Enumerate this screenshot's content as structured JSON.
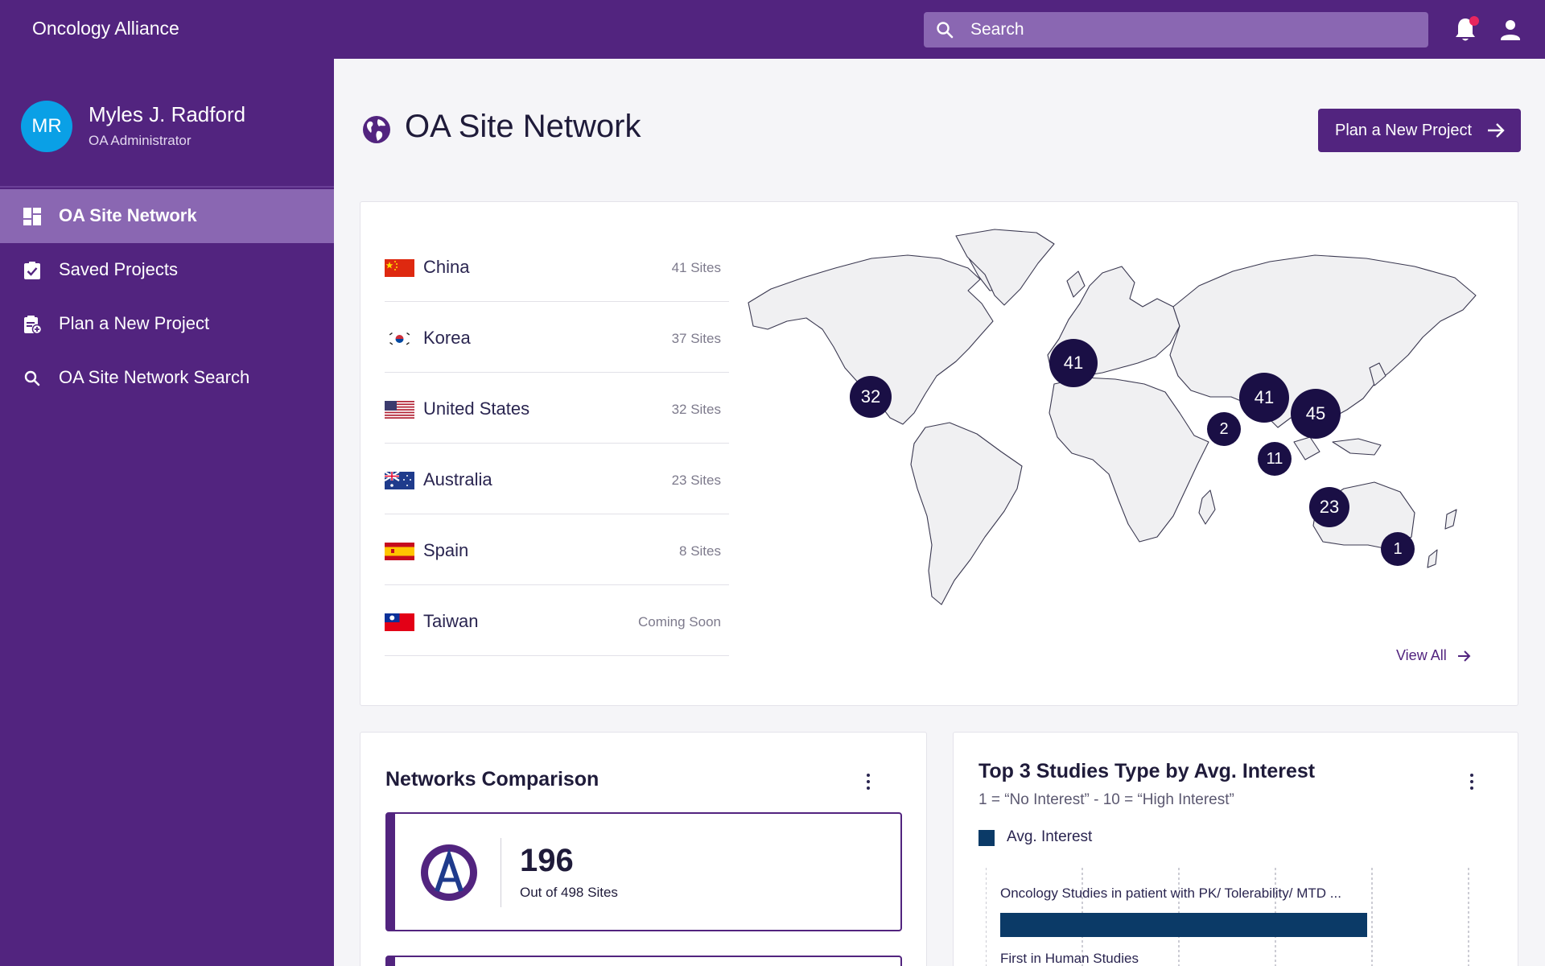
{
  "app": {
    "title": "Oncology Alliance"
  },
  "search": {
    "placeholder": "Search"
  },
  "user": {
    "initials": "MR",
    "name": "Myles J. Radford",
    "role": "OA Administrator"
  },
  "sidebar": {
    "items": [
      {
        "label": "OA Site Network",
        "icon": "dashboard-icon",
        "active": true
      },
      {
        "label": "Saved Projects",
        "icon": "clipboard-check-icon",
        "active": false
      },
      {
        "label": "Plan a New Project",
        "icon": "clipboard-add-icon",
        "active": false
      },
      {
        "label": "OA Site Network Search",
        "icon": "search-icon",
        "active": false
      }
    ]
  },
  "page": {
    "title": "OA Site Network",
    "primary_button": "Plan a New Project"
  },
  "countries": [
    {
      "name": "China",
      "sites": "41 Sites",
      "flag": "china-flag"
    },
    {
      "name": "Korea",
      "sites": "37 Sites",
      "flag": "korea-flag"
    },
    {
      "name": "United States",
      "sites": "32 Sites",
      "flag": "usa-flag"
    },
    {
      "name": "Australia",
      "sites": "23 Sites",
      "flag": "australia-flag"
    },
    {
      "name": "Spain",
      "sites": "8 Sites",
      "flag": "spain-flag"
    },
    {
      "name": "Taiwan",
      "sites": "Coming Soon",
      "flag": "taiwan-flag"
    }
  ],
  "map": {
    "clusters": [
      "32",
      "41",
      "41",
      "45",
      "2",
      "11",
      "23",
      "1"
    ],
    "view_all": "View All"
  },
  "comparison": {
    "title": "Networks Comparison",
    "value": "196",
    "subtitle": "Out of 498 Sites"
  },
  "studies": {
    "title": "Top 3 Studies Type by Avg. Interest",
    "subtitle": "1 = “No Interest” - 10 = “High Interest”",
    "legend": "Avg. Interest"
  },
  "chart_data": {
    "type": "bar",
    "orientation": "horizontal",
    "categories": [
      "Oncology Studies in patient with PK/ Tolerability/ MTD ...",
      "First in Human Studies"
    ],
    "series": [
      {
        "name": "Avg. Interest",
        "values": [
          7.9,
          null
        ]
      }
    ],
    "xlim": [
      0,
      10
    ],
    "grid": true,
    "legend_position": "top-left",
    "color": "#0b3a67"
  },
  "colors": {
    "brand": "#52247f",
    "accent": "#8a67b2",
    "cluster": "#1a0f45",
    "bar": "#0b3a67",
    "notification": "#e8265e"
  }
}
